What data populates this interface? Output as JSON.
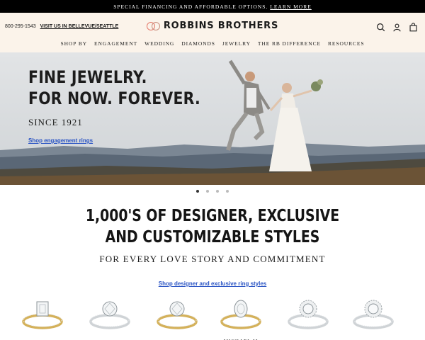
{
  "promo": {
    "text": "SPECIAL FINANCING AND AFFORDABLE OPTIONS.",
    "link": "LEARN MORE"
  },
  "header": {
    "phone": "800-295-1543",
    "location_link": "VISIT US IN BELLEVUE/SEATTLE",
    "logo_text": "ROBBINS BROTHERS",
    "icons": [
      "search-icon",
      "account-icon",
      "bag-icon"
    ]
  },
  "nav": {
    "items": [
      {
        "label": "SHOP BY"
      },
      {
        "label": "ENGAGEMENT"
      },
      {
        "label": "WEDDING"
      },
      {
        "label": "DIAMONDS"
      },
      {
        "label": "JEWELRY"
      },
      {
        "label": "THE RB DIFFERENCE"
      },
      {
        "label": "RESOURCES"
      }
    ]
  },
  "hero": {
    "title_line1": "FINE JEWELRY.",
    "title_line2": "FOR NOW. FOREVER.",
    "subtitle": "SINCE 1921",
    "link": "Shop engagement rings",
    "slides": {
      "count": 4,
      "active": 1
    }
  },
  "section": {
    "title_line1": "1,000'S OF DESIGNER, EXCLUSIVE",
    "title_line2": "AND CUSTOMIZABLE STYLES",
    "subtitle": "FOR EVERY LOVE STORY AND COMMITMENT",
    "link": "Shop designer and exclusive ring styles"
  },
  "rings": [
    {
      "label": "",
      "metal": "yellow-gold",
      "stone": "emerald-cut"
    },
    {
      "label": "",
      "metal": "white-gold",
      "stone": "round"
    },
    {
      "label": "",
      "metal": "yellow-gold",
      "stone": "round"
    },
    {
      "label": "MICHAEL M",
      "metal": "yellow-gold",
      "stone": "oval"
    },
    {
      "label": "",
      "metal": "white-gold",
      "stone": "halo"
    },
    {
      "label": "",
      "metal": "white-gold",
      "stone": "halo"
    }
  ],
  "colors": {
    "header_bg": "#fbf3ea",
    "link": "#2a54c4",
    "logo_accent": "#e5796a",
    "gold": "#d4b15a",
    "silver": "#cfd3d6"
  }
}
